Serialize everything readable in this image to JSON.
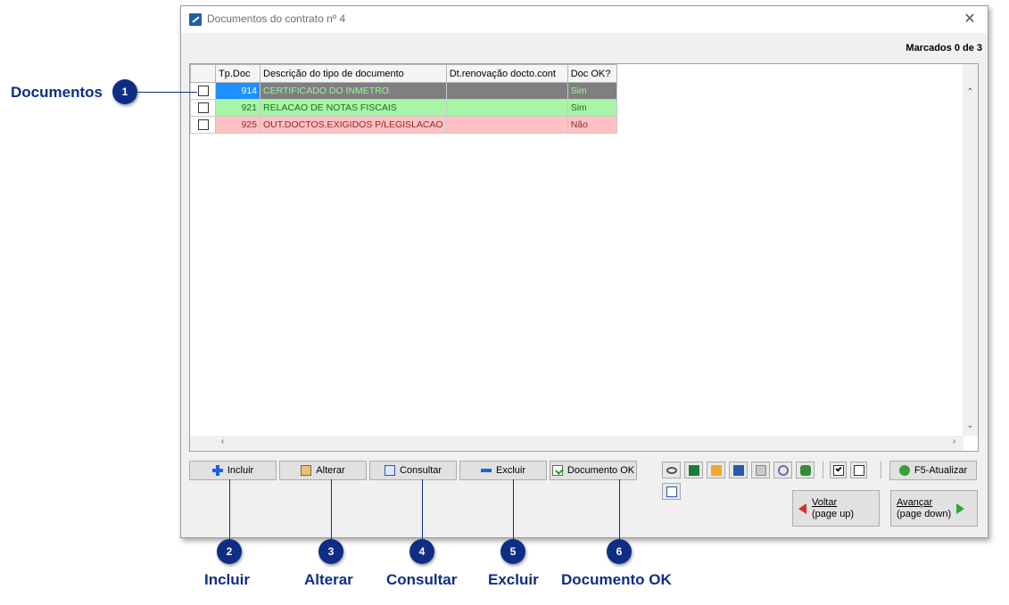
{
  "window": {
    "title": "Documentos do contrato nº 4",
    "close_glyph": "✕",
    "marcados": "Marcados 0 de 3"
  },
  "grid": {
    "columns": [
      "Tp.Doc",
      "Descrição do tipo de documento",
      "Dt.renovação docto.cont",
      "Doc OK?"
    ],
    "rows": [
      {
        "tp": "914",
        "desc": "CERTIFICADO DO INMETRO",
        "dt": "",
        "ok": "Sim",
        "style": "selected"
      },
      {
        "tp": "921",
        "desc": "RELACAO DE NOTAS FISCAIS",
        "dt": "",
        "ok": "Sim",
        "style": "green"
      },
      {
        "tp": "925",
        "desc": "OUT.DOCTOS.EXIGIDOS P/LEGISLACAO",
        "dt": "",
        "ok": "Não",
        "style": "red"
      }
    ]
  },
  "buttons": {
    "incluir": "Incluir",
    "alterar": "Alterar",
    "consultar": "Consultar",
    "excluir": "Excluir",
    "documento_ok": "Documento OK",
    "atualizar": "F5-Atualizar",
    "voltar_line1": "Voltar",
    "voltar_line2": "(page up)",
    "avancar_line1": "Avançar",
    "avancar_line2": "(page down)"
  },
  "toolbar_icons": [
    "view-icon",
    "excel-icon",
    "folder-icon",
    "sort-icon",
    "print-icon",
    "settings-icon",
    "export-icon",
    "check-all-icon",
    "uncheck-all-icon",
    "checklist-icon"
  ],
  "callouts": [
    {
      "num": "1",
      "label": "Documentos"
    },
    {
      "num": "2",
      "label": "Incluir"
    },
    {
      "num": "3",
      "label": "Alterar"
    },
    {
      "num": "4",
      "label": "Consultar"
    },
    {
      "num": "5",
      "label": "Excluir"
    },
    {
      "num": "6",
      "label": "Documento OK"
    }
  ],
  "colors": {
    "callout": "#0e2e86",
    "row_selected": "#7f7f7f",
    "row_green": "#a8f5a8",
    "row_red": "#ffc1c1",
    "cell_selected": "#1e90ff"
  }
}
